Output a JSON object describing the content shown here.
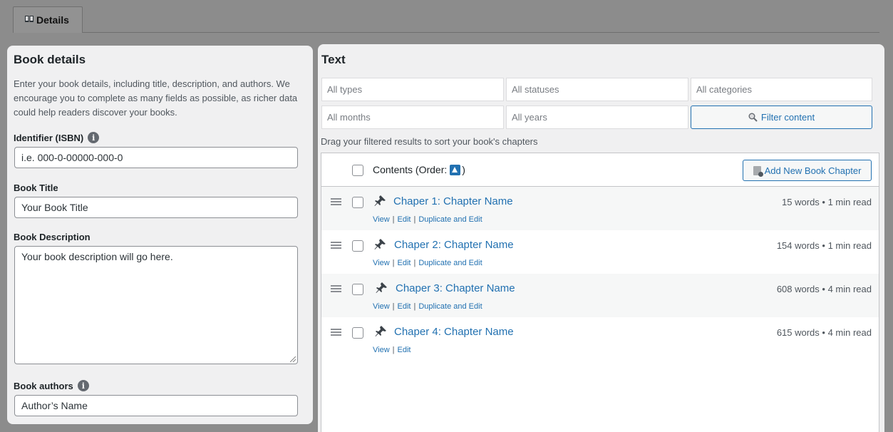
{
  "tab": {
    "label": "Details"
  },
  "book": {
    "heading": "Book details",
    "intro": "Enter your book details, including title, description, and authors. We encourage you to complete as many fields as possible, as richer data could help readers discover your books.",
    "isbn_label": "Identifier (ISBN)",
    "isbn_value": "i.e. 000-0-00000-000-0",
    "title_label": "Book Title",
    "title_value": "Your Book Title",
    "desc_label": "Book Description",
    "desc_value": "Your book description will go here.",
    "authors_label": "Book authors",
    "authors_value": "Author’s Name"
  },
  "text": {
    "heading": "Text",
    "filters": {
      "types": "All types",
      "statuses": "All statuses",
      "categories": "All categories",
      "months": "All months",
      "years": "All years",
      "button": "Filter content"
    },
    "drag_hint": "Drag your filtered results to sort your book's chapters",
    "contents_label": "Contents (Order:",
    "contents_suffix": ")",
    "add_button": "Add New Book Chapter",
    "actions": {
      "view": "View",
      "edit": "Edit",
      "duplicate": "Duplicate and Edit",
      "separator": "|"
    },
    "chapters": [
      {
        "title": "Chaper 1: Chapter Name",
        "meta": "15 words • 1 min read"
      },
      {
        "title": "Chaper 2: Chapter Name",
        "meta": "154 words • 1 min read"
      },
      {
        "title": "Chaper 3: Chapter Name",
        "meta": "608 words • 4 min read"
      },
      {
        "title": "Chaper 4: Chapter Name",
        "meta": "615 words • 4 min read"
      }
    ]
  },
  "colors": {
    "accent": "#2271b1",
    "panel": "#f0f0f1",
    "backdrop": "#8c8c8c"
  }
}
